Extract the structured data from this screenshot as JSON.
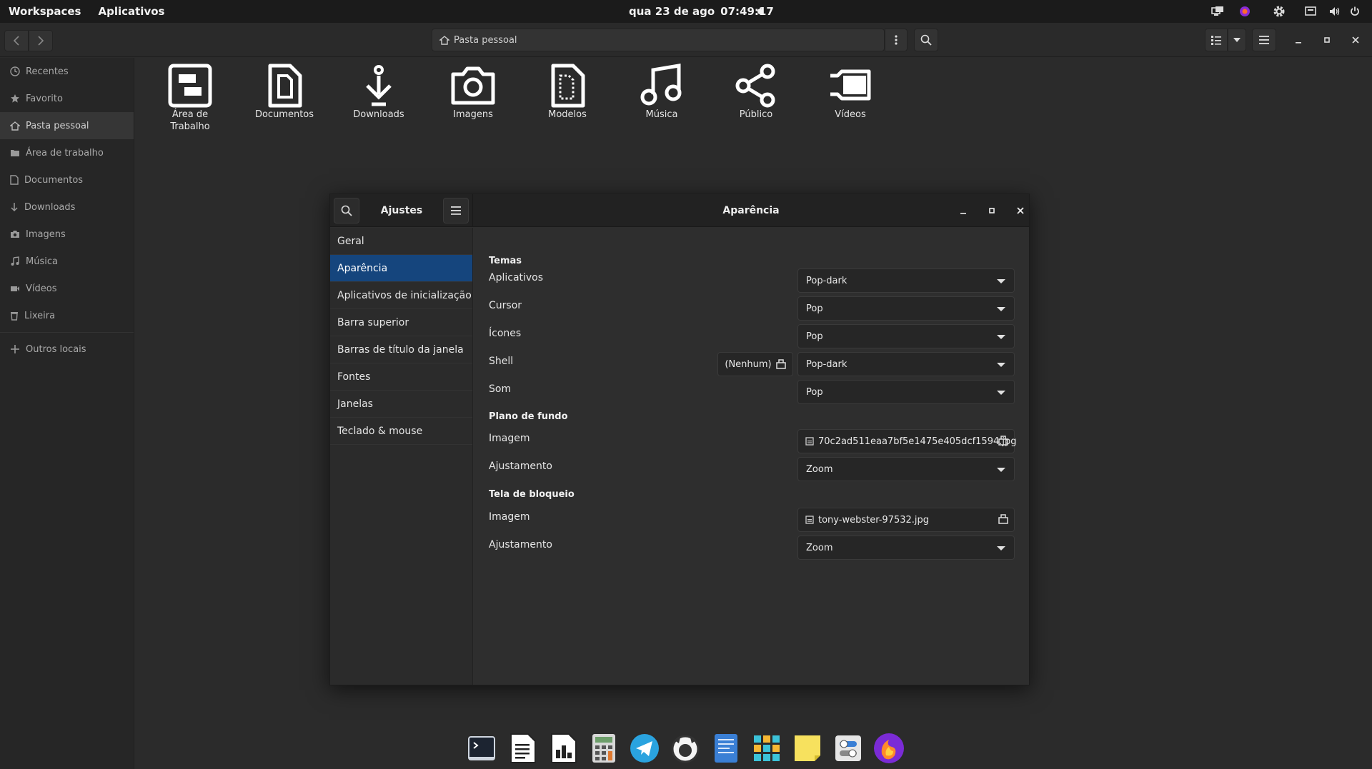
{
  "topbar": {
    "workspaces": "Workspaces",
    "apps": "Aplicativos",
    "date": "qua 23 de ago",
    "time": "07:49:17"
  },
  "filemanager": {
    "path": "Pasta pessoal",
    "sidebar": [
      {
        "label": "Recentes",
        "icon": "clock-icon"
      },
      {
        "label": "Favorito",
        "icon": "star-icon"
      },
      {
        "label": "Pasta pessoal",
        "icon": "home-icon",
        "active": true
      },
      {
        "label": "Área de trabalho",
        "icon": "folder-icon"
      },
      {
        "label": "Documentos",
        "icon": "document-icon"
      },
      {
        "label": "Downloads",
        "icon": "download-icon"
      },
      {
        "label": "Imagens",
        "icon": "camera-icon"
      },
      {
        "label": "Música",
        "icon": "music-icon"
      },
      {
        "label": "Vídeos",
        "icon": "video-icon"
      },
      {
        "label": "Lixeira",
        "icon": "trash-icon"
      },
      {
        "label": "Outros locais",
        "icon": "plus-icon"
      }
    ],
    "folders": [
      {
        "label_1": "Área de",
        "label_2": "Trabalho",
        "icon": "desktop-folder-icon"
      },
      {
        "label_1": "Documentos",
        "label_2": "",
        "icon": "documents-folder-icon"
      },
      {
        "label_1": "Downloads",
        "label_2": "",
        "icon": "downloads-folder-icon"
      },
      {
        "label_1": "Imagens",
        "label_2": "",
        "icon": "pictures-folder-icon"
      },
      {
        "label_1": "Modelos",
        "label_2": "",
        "icon": "templates-folder-icon"
      },
      {
        "label_1": "Música",
        "label_2": "",
        "icon": "music-folder-icon"
      },
      {
        "label_1": "Público",
        "label_2": "",
        "icon": "public-folder-icon"
      },
      {
        "label_1": "Vídeos",
        "label_2": "",
        "icon": "videos-folder-icon"
      }
    ]
  },
  "tweaks": {
    "app_title": "Ajustes",
    "page_title": "Aparência",
    "nav": [
      "Geral",
      "Aparência",
      "Aplicativos de inicialização",
      "Barra superior",
      "Barras de título da janela",
      "Fontes",
      "Janelas",
      "Teclado & mouse"
    ],
    "selected_nav": "Aparência",
    "sections": {
      "themes": "Temas",
      "background": "Plano de fundo",
      "lock": "Tela de bloqueio"
    },
    "rows": {
      "apps_label": "Aplicativos",
      "apps_value": "Pop-dark",
      "cursor_label": "Cursor",
      "cursor_value": "Pop",
      "icons_label": "Ícones",
      "icons_value": "Pop",
      "shell_label": "Shell",
      "shell_value": "Pop-dark",
      "shell_file": "(Nenhum)",
      "sound_label": "Som",
      "sound_value": "Pop",
      "bg_image_label": "Imagem",
      "bg_image_value": "70c2ad511eaa7bf5e1475e405dcf1594.jpg",
      "bg_adjust_label": "Ajustamento",
      "bg_adjust_value": "Zoom",
      "lock_image_label": "Imagem",
      "lock_image_value": "tony-webster-97532.jpg",
      "lock_adjust_label": "Ajustamento",
      "lock_adjust_value": "Zoom"
    }
  },
  "dock": [
    "terminal-icon",
    "writer-icon",
    "impress-icon",
    "calculator-icon",
    "telegram-icon",
    "gimp-icon",
    "text-editor-icon",
    "app-grid-icon",
    "notes-icon",
    "tweaks-icon",
    "firefox-icon"
  ]
}
